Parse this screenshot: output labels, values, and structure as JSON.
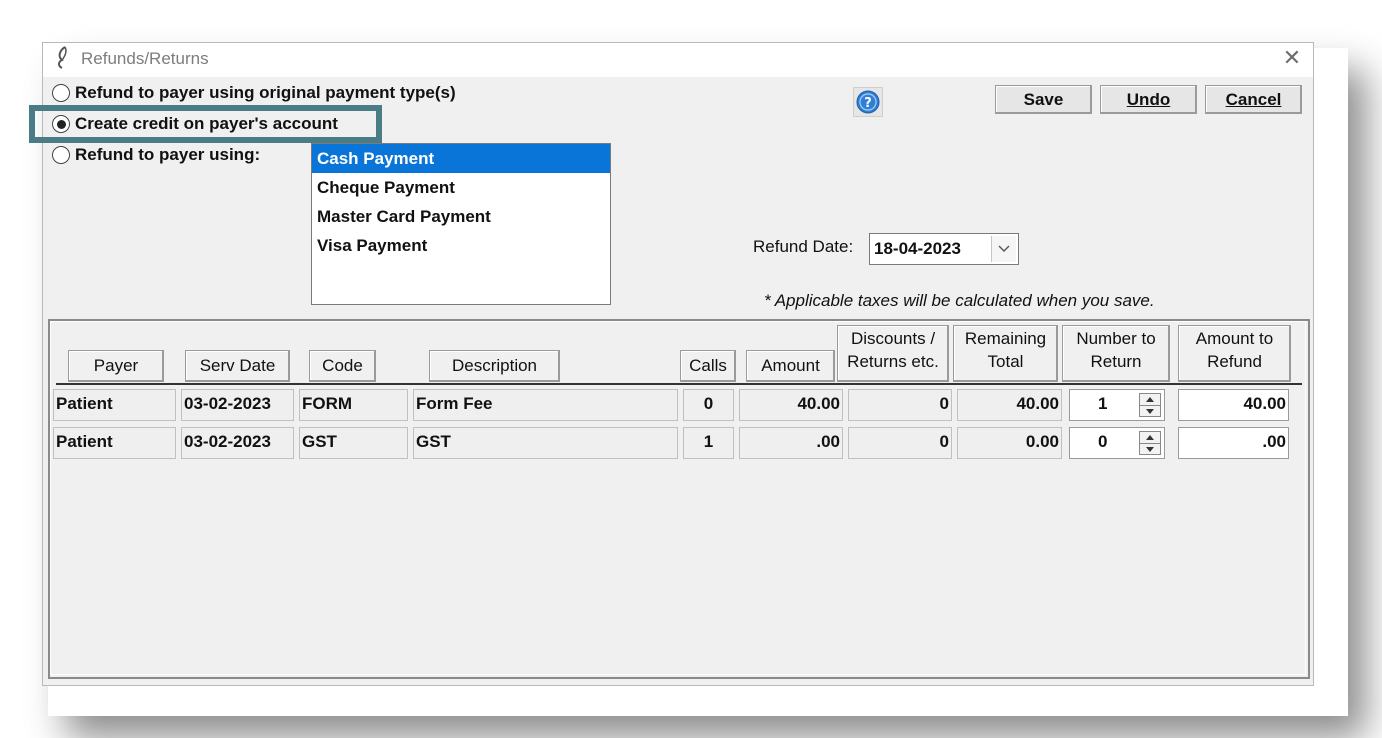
{
  "window": {
    "title": "Refunds/Returns"
  },
  "options": {
    "original": "Refund to payer using original payment type(s)",
    "credit": "Create credit on payer's account",
    "using": "Refund to payer using:"
  },
  "payment_types": [
    "Cash Payment",
    "Cheque Payment",
    "Master Card Payment",
    "Visa Payment"
  ],
  "selected_payment": "Cash Payment",
  "buttons": {
    "save": "Save",
    "undo": "Undo",
    "cancel": "Cancel"
  },
  "refund_date": {
    "label": "Refund Date:",
    "value": "18-04-2023"
  },
  "tax_note": "* Applicable taxes will be calculated when you save.",
  "columns": {
    "payer": "Payer",
    "serv_date": "Serv Date",
    "code": "Code",
    "description": "Description",
    "calls": "Calls",
    "amount": "Amount",
    "discounts_l1": "Discounts /",
    "discounts_l2": "Returns etc.",
    "remaining_l1": "Remaining",
    "remaining_l2": "Total",
    "number_l1": "Number to",
    "number_l2": "Return",
    "refund_l1": "Amount to",
    "refund_l2": "Refund"
  },
  "rows": [
    {
      "payer": "Patient",
      "serv_date": "03-02-2023",
      "code": "FORM",
      "description": "Form Fee",
      "calls": "0",
      "amount": "40.00",
      "discounts": "0",
      "remaining": "40.00",
      "number": "1",
      "refund": "40.00"
    },
    {
      "payer": "Patient",
      "serv_date": "03-02-2023",
      "code": "GST",
      "description": "GST",
      "calls": "1",
      "amount": ".00",
      "discounts": "0",
      "remaining": "0.00",
      "number": "0",
      "refund": ".00"
    }
  ],
  "colors": {
    "selection": "#0a75d8",
    "highlight_border": "#4a7c86"
  },
  "icons": {
    "app": "quill-icon",
    "help": "help-icon",
    "close": "close-icon"
  }
}
